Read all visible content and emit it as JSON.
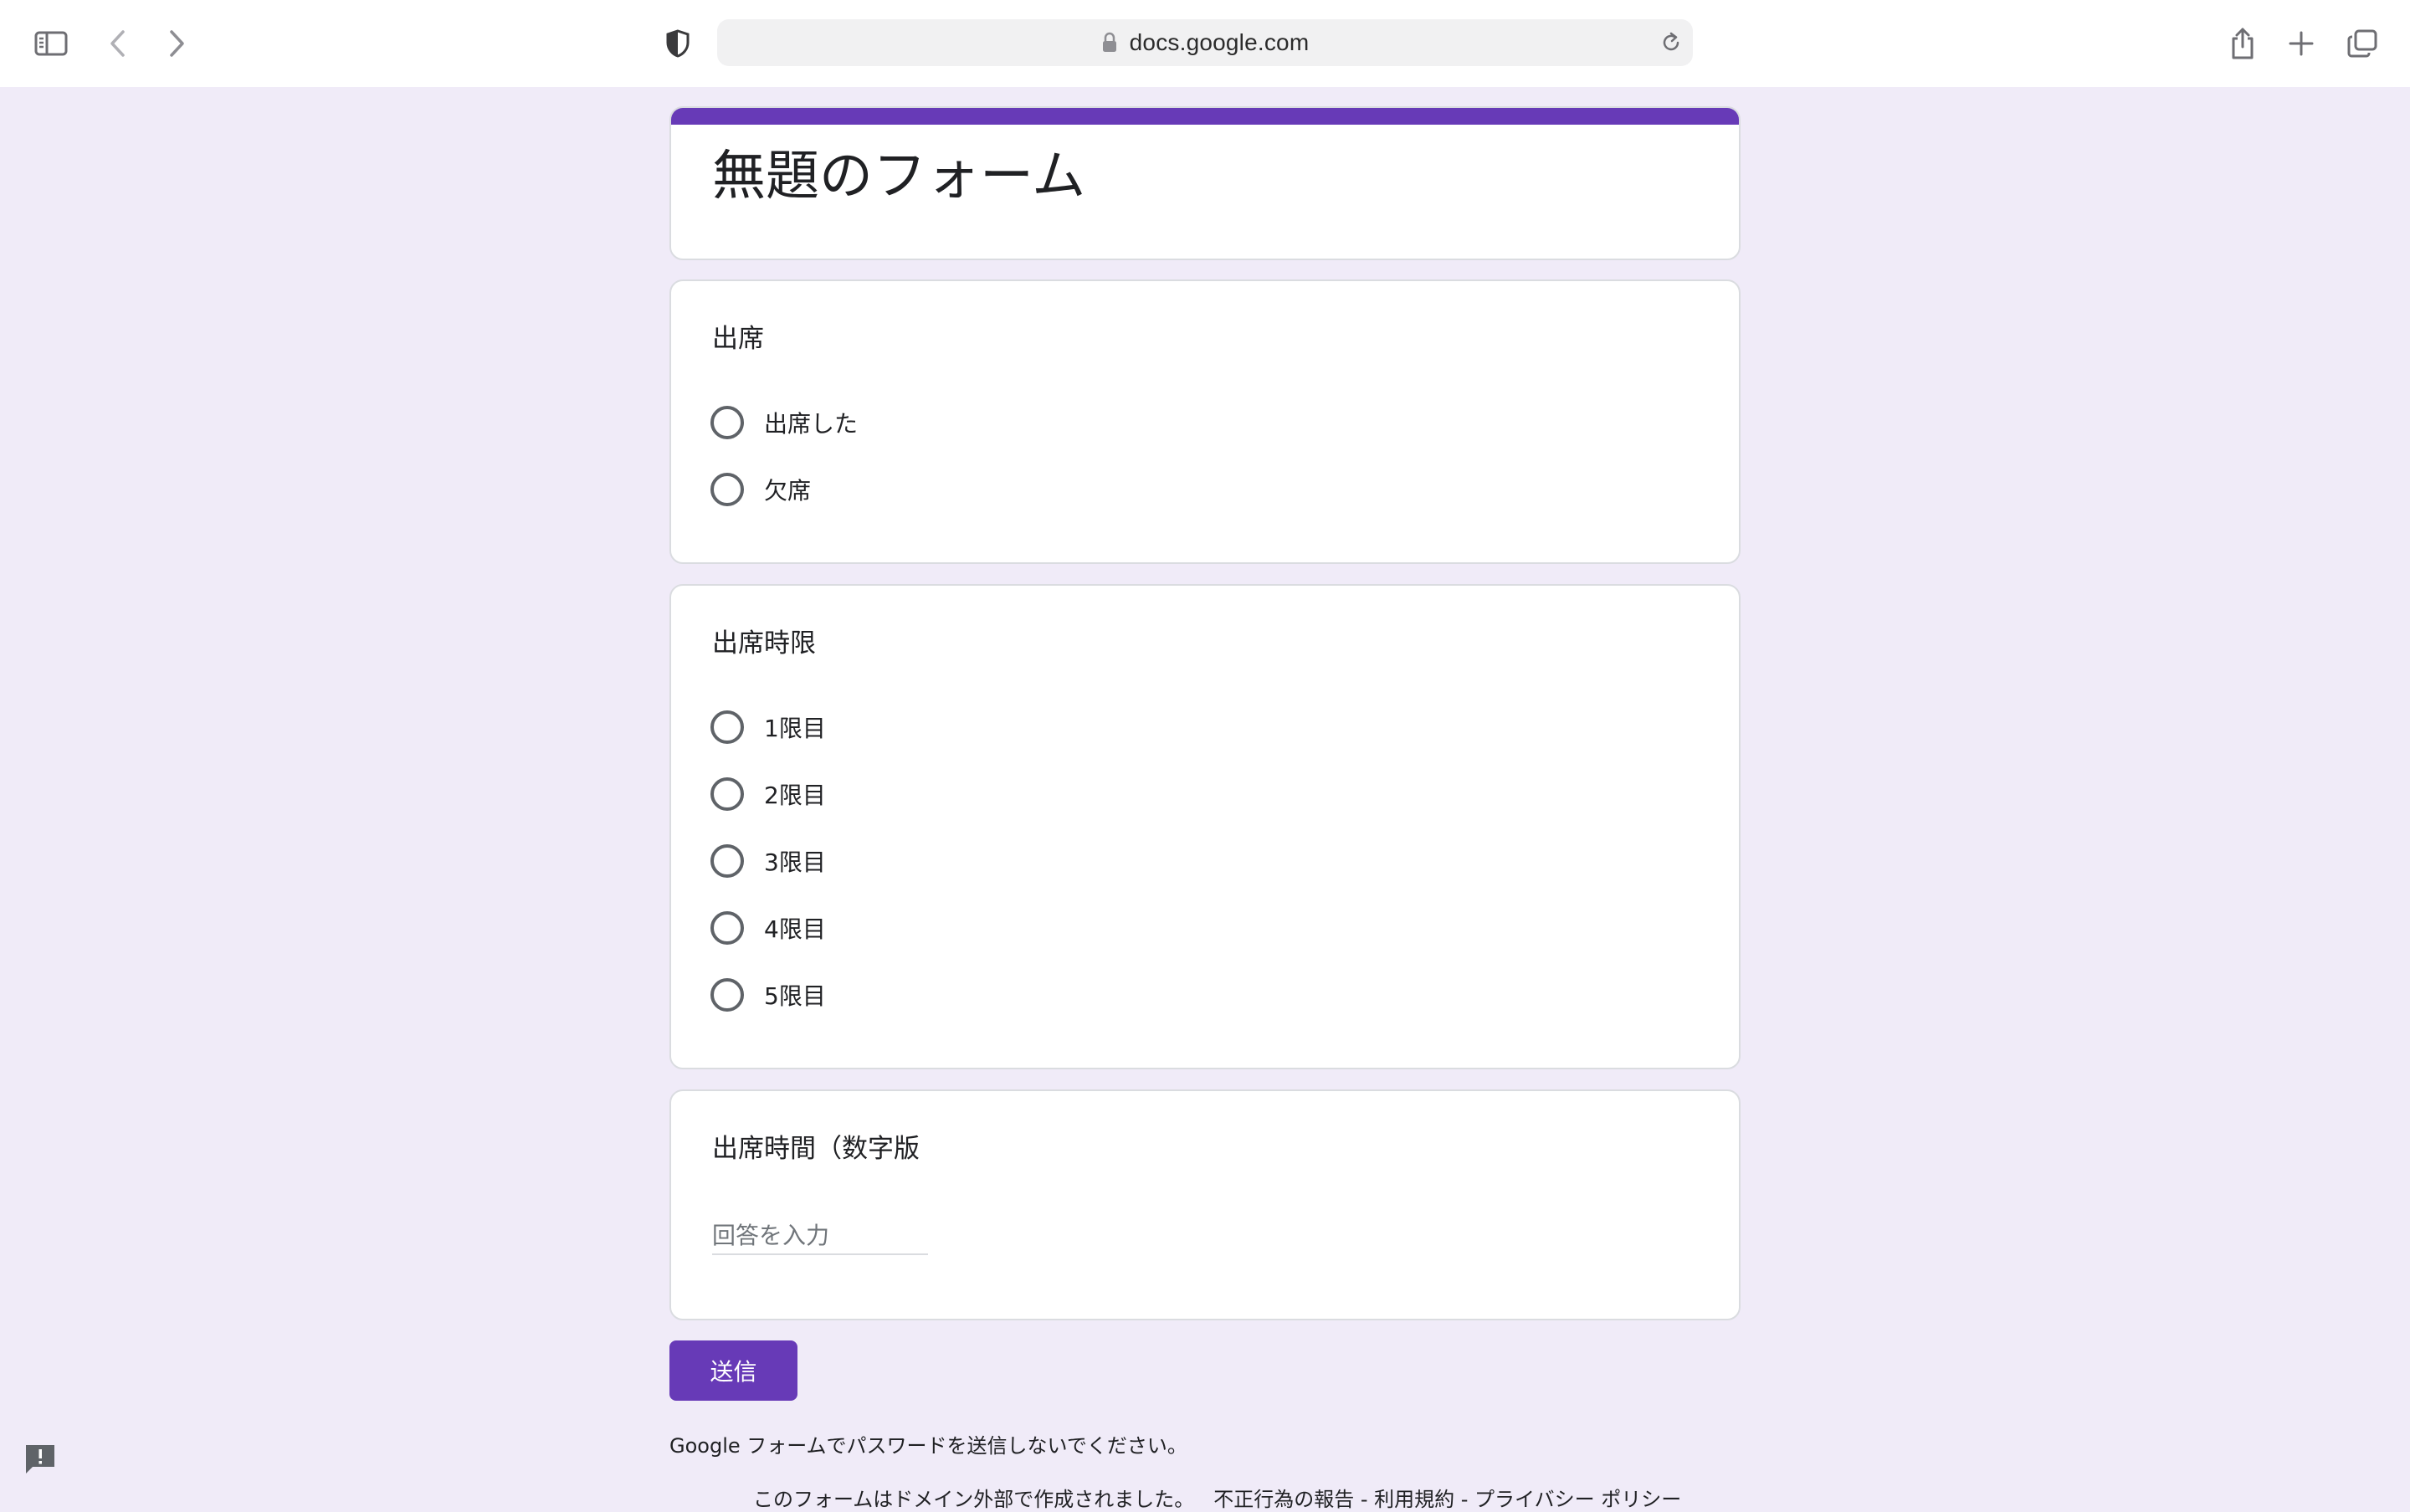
{
  "browser": {
    "url": "docs.google.com"
  },
  "form": {
    "title": "無題のフォーム",
    "questions": [
      {
        "title": "出席",
        "options": [
          "出席した",
          "欠席"
        ]
      },
      {
        "title": "出席時限",
        "options": [
          "1限目",
          "2限目",
          "3限目",
          "4限目",
          "5限目"
        ]
      },
      {
        "title": "出席時間（数字版",
        "placeholder": "回答を入力"
      }
    ],
    "submit_label": "送信",
    "warning": "Google フォームでパスワードを送信しないでください。",
    "footer": {
      "notice": "このフォームはドメイン外部で作成されました。",
      "report": "不正行為の報告",
      "sep": " - ",
      "terms": "利用規約",
      "privacy": "プライバシー ポリシー"
    }
  },
  "colors": {
    "accent": "#673ab7",
    "background": "#f0ebf8"
  },
  "icons": [
    "sidebar-icon",
    "back-chevron-icon",
    "forward-chevron-icon",
    "shield-icon",
    "lock-icon",
    "reload-icon",
    "share-icon",
    "plus-icon",
    "tabs-icon",
    "feedback-icon"
  ]
}
